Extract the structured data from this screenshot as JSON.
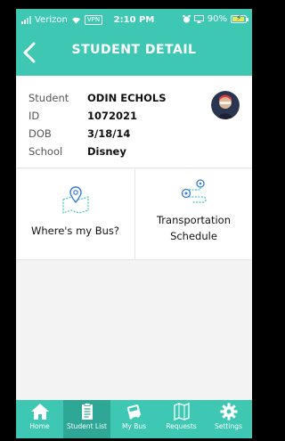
{
  "status_bar": {
    "carrier": "Verizon",
    "vpn": "VPN",
    "time": "2:10 PM",
    "battery": "90%",
    "battery_level": 0.9,
    "icons": [
      "signal-icon",
      "wifi-icon",
      "alarm-icon",
      "screen-mirror-icon",
      "battery-icon"
    ]
  },
  "header": {
    "title": "STUDENT DETAIL",
    "back_icon": "chevron-left-icon"
  },
  "student": {
    "labels": {
      "student": "Student",
      "id": "ID",
      "dob": "DOB",
      "school": "School"
    },
    "name": "ODIN ECHOLS",
    "id": "1072021",
    "dob": "3/18/14",
    "school": "Disney"
  },
  "tiles": [
    {
      "label": "Where's my Bus?",
      "icon": "map-pin-icon"
    },
    {
      "label_line1": "Transportation",
      "label_line2": "Schedule",
      "icon": "route-icon"
    }
  ],
  "nav": {
    "items": [
      {
        "label": "Home",
        "icon": "home-icon",
        "active": false
      },
      {
        "label": "Student List",
        "icon": "clipboard-icon",
        "active": true
      },
      {
        "label": "My Bus",
        "icon": "bus-icon",
        "active": false
      },
      {
        "label": "Requests",
        "icon": "map-icon",
        "active": false
      },
      {
        "label": "Settings",
        "icon": "gear-icon",
        "active": false
      }
    ]
  },
  "colors": {
    "teal": "#3ec8b4",
    "teal_active": "#2ea796",
    "background": "#f3f3f3"
  }
}
